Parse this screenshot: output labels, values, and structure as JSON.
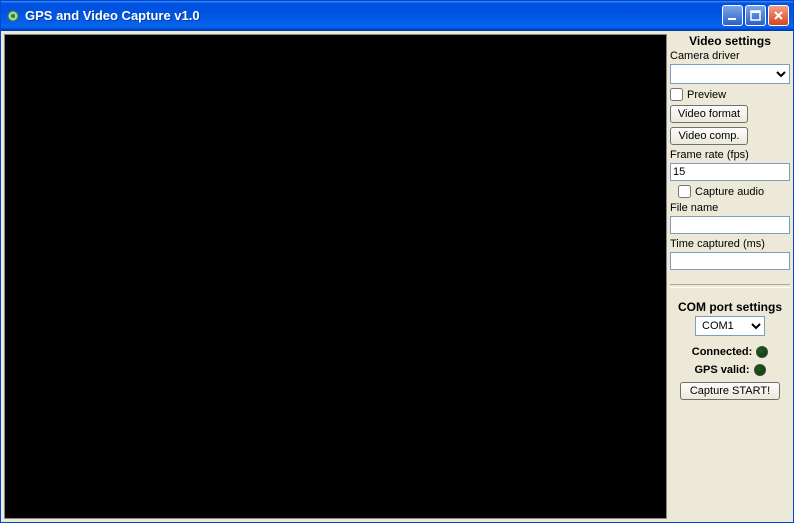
{
  "titlebar": {
    "text": "GPS and Video Capture v1.0"
  },
  "video_settings": {
    "title": "Video settings",
    "camera_driver_label": "Camera driver",
    "camera_driver_value": "",
    "preview_label": "Preview",
    "video_format_btn": "Video format",
    "video_comp_btn": "Video comp.",
    "frame_rate_label": "Frame rate (fps)",
    "frame_rate_value": "15",
    "capture_audio_label": "Capture audio",
    "file_name_label": "File name",
    "file_name_value": "",
    "time_captured_label": "Time captured (ms)",
    "time_captured_value": ""
  },
  "com_settings": {
    "title": "COM port settings",
    "port_value": "COM1",
    "connected_label": "Connected:",
    "gps_valid_label": "GPS valid:",
    "capture_btn": "Capture START!"
  }
}
